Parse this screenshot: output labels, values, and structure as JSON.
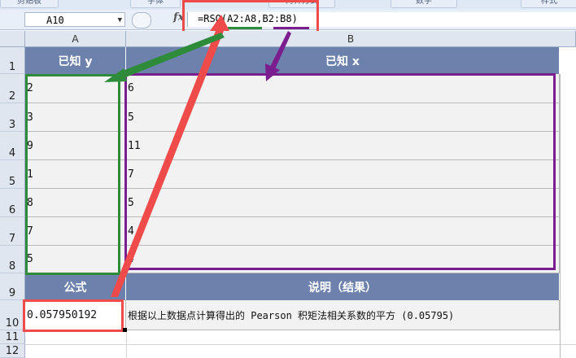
{
  "ribbon": {
    "groups": [
      "剪贴板",
      "字体",
      "对齐方式",
      "数字",
      "样式"
    ]
  },
  "formula_bar": {
    "name_box": "A10",
    "fx_label": "fx",
    "formula": "=RSQ(A2:A8,B2:B8)"
  },
  "columns": [
    "A",
    "B"
  ],
  "rows": [
    "1",
    "2",
    "3",
    "4",
    "5",
    "6",
    "7",
    "8",
    "9",
    "10",
    "11",
    "12"
  ],
  "header_row": {
    "a": "已知 y",
    "b": "已知 x"
  },
  "data": [
    {
      "y": "2",
      "x": "6"
    },
    {
      "y": "3",
      "x": "5"
    },
    {
      "y": "9",
      "x": "11"
    },
    {
      "y": "1",
      "x": "7"
    },
    {
      "y": "8",
      "x": "5"
    },
    {
      "y": "7",
      "x": "4"
    },
    {
      "y": "5",
      "x": "4"
    }
  ],
  "formula_row": {
    "a": "公式",
    "b": "说明（结果）"
  },
  "result_row": {
    "a": "0.057950192",
    "b": "根据以上数据点计算得出的 Pearson 积矩法相关系数的平方 (0.05795)"
  },
  "colors": {
    "header_fill": "#6d81ad",
    "green_box": "#2e8b3a",
    "purple_box": "#7a1d8f",
    "red_box": "#ef4b4b"
  }
}
